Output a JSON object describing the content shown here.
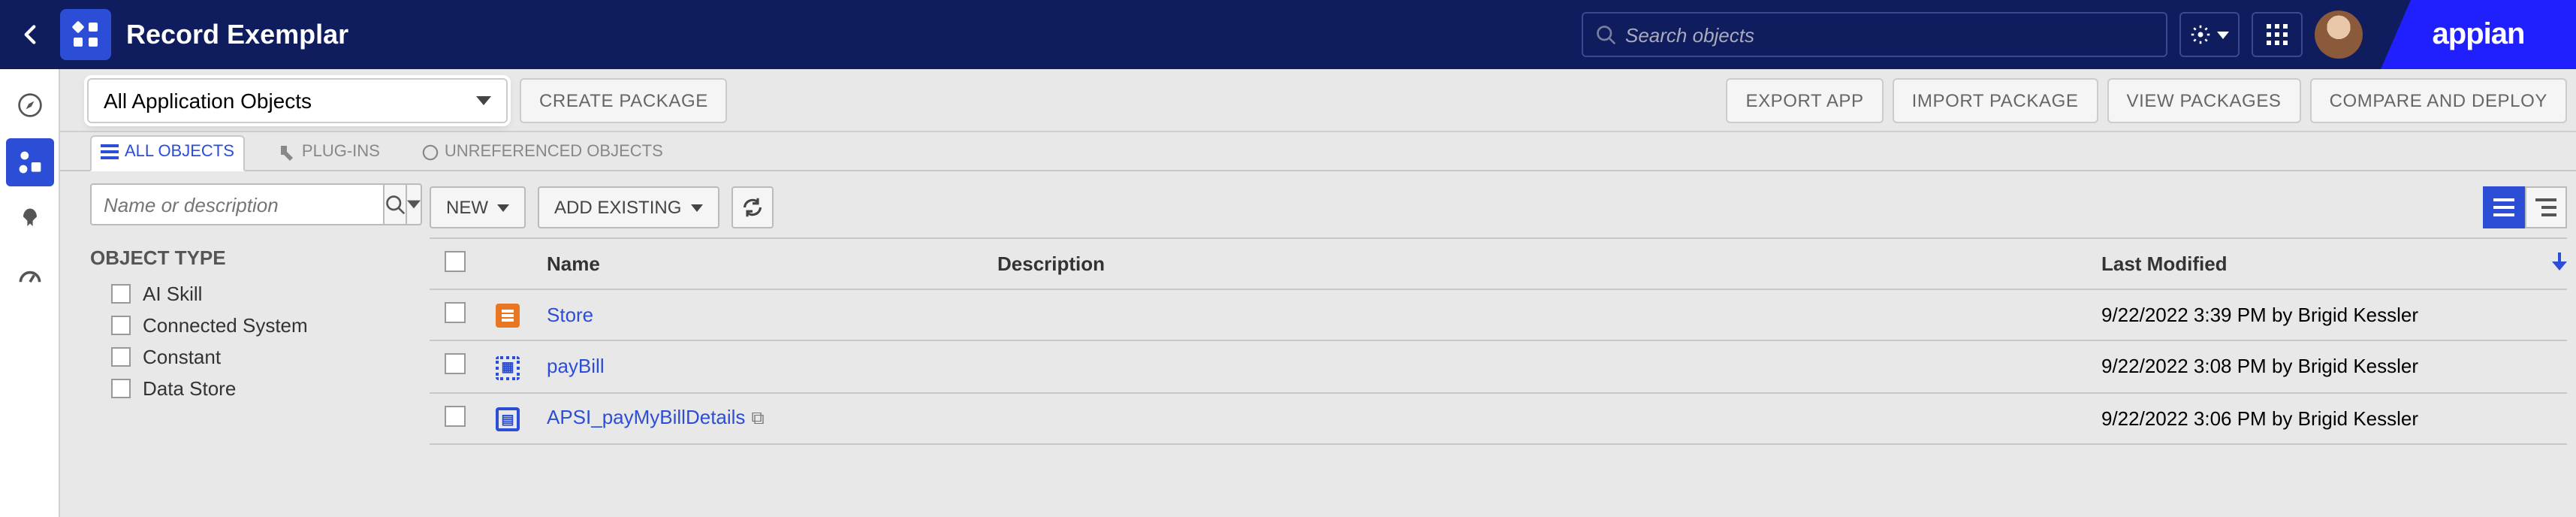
{
  "header": {
    "title": "Record Exemplar",
    "search_placeholder": "Search objects",
    "logo": "appian"
  },
  "toolbar": {
    "scope_label": "All Application Objects",
    "create_package": "CREATE PACKAGE",
    "export_app": "EXPORT APP",
    "import_package": "IMPORT PACKAGE",
    "view_packages": "VIEW PACKAGES",
    "compare_deploy": "COMPARE AND DEPLOY"
  },
  "tabs": {
    "all_objects": "ALL OBJECTS",
    "plugins": "PLUG-INS",
    "unreferenced": "UNREFERENCED OBJECTS"
  },
  "sidebar": {
    "filter_placeholder": "Name or description",
    "object_type_heading": "OBJECT TYPE",
    "items": [
      {
        "label": "AI Skill"
      },
      {
        "label": "Connected System"
      },
      {
        "label": "Constant"
      },
      {
        "label": "Data Store"
      }
    ]
  },
  "table": {
    "actions": {
      "new": "NEW",
      "add_existing": "ADD EXISTING"
    },
    "columns": {
      "name": "Name",
      "description": "Description",
      "last_modified": "Last Modified"
    },
    "rows": [
      {
        "name": "Store",
        "description": "",
        "last_modified": "9/22/2022 3:39 PM by Brigid Kessler",
        "icon": "i-store"
      },
      {
        "name": "payBill",
        "description": "",
        "last_modified": "9/22/2022 3:08 PM by Brigid Kessler",
        "icon": "i-paybill"
      },
      {
        "name": "APSI_payMyBillDetails",
        "description": "",
        "last_modified": "9/22/2022 3:06 PM by Brigid Kessler",
        "icon": "i-apsi",
        "security_icon": true
      }
    ]
  }
}
